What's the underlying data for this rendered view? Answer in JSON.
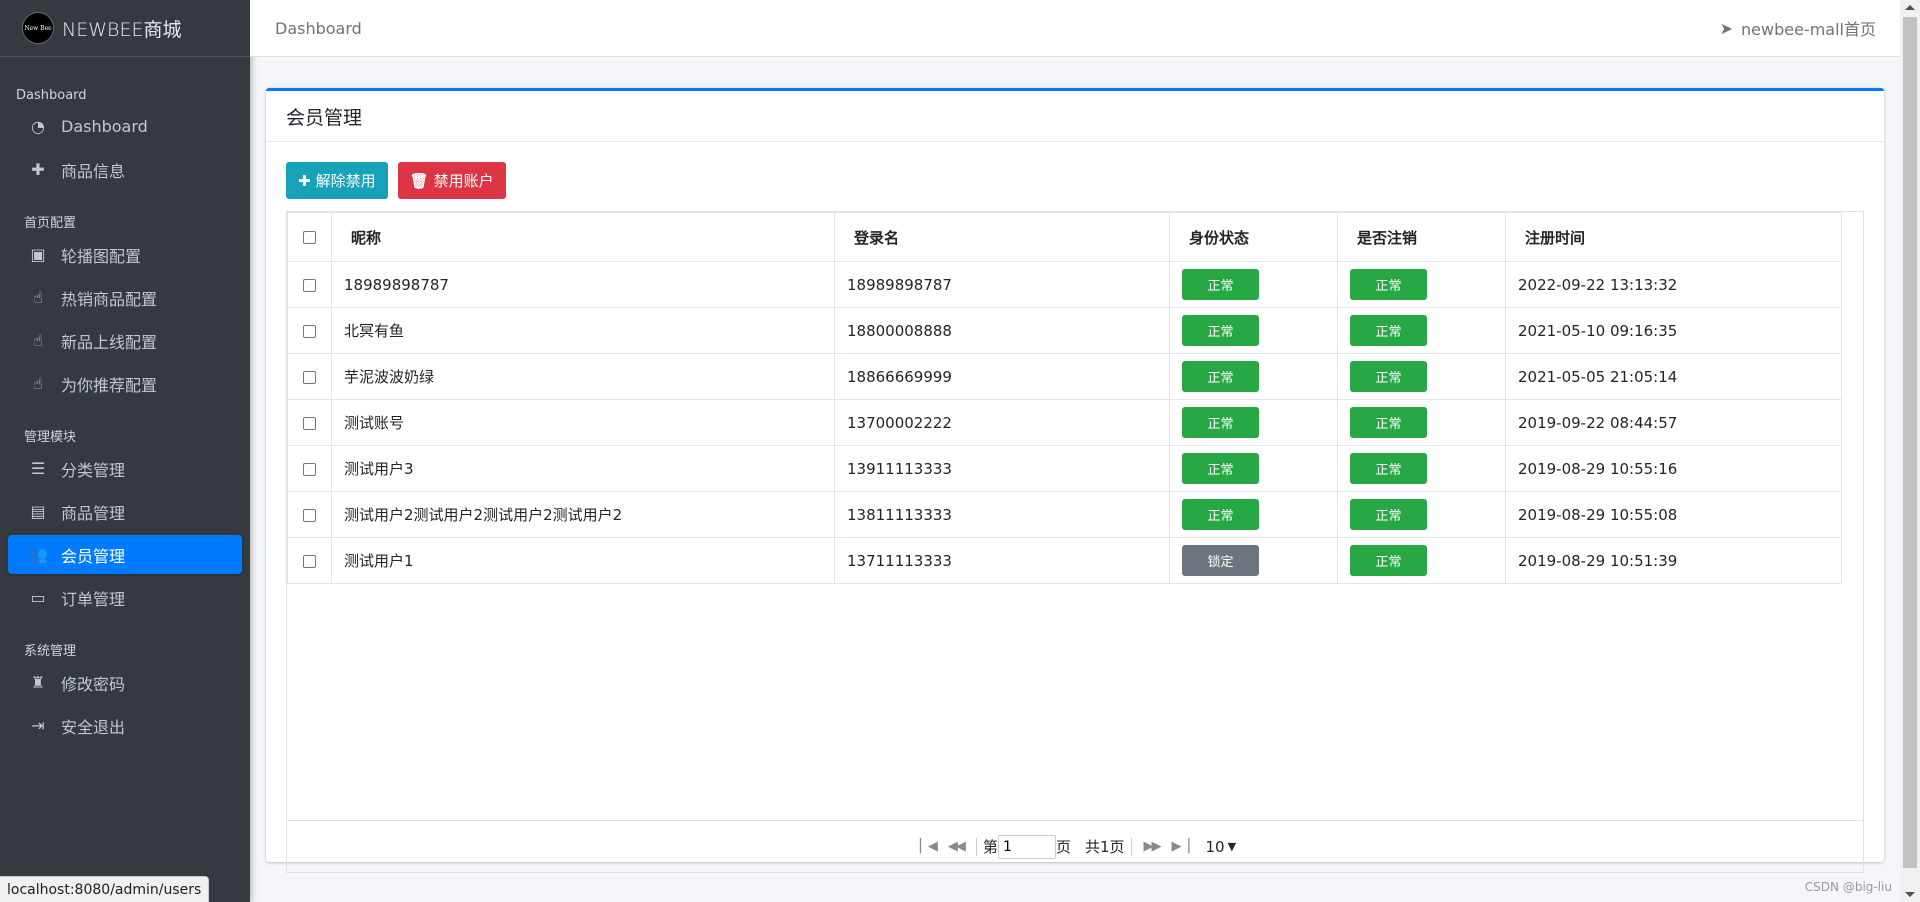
{
  "brand": {
    "logo_text": "New Bee",
    "title": "NEWBEE商城"
  },
  "sidebar": {
    "sections": [
      {
        "header": "Dashboard",
        "items": [
          {
            "label": "Dashboard",
            "icon": "tachometer-icon"
          },
          {
            "label": "商品信息",
            "icon": "plus-icon"
          }
        ]
      },
      {
        "header": "首页配置",
        "items": [
          {
            "label": "轮播图配置",
            "icon": "image-icon"
          },
          {
            "label": "热销商品配置",
            "icon": "hand-pointer-icon"
          },
          {
            "label": "新品上线配置",
            "icon": "hand-pointer-icon"
          },
          {
            "label": "为你推荐配置",
            "icon": "hand-pointer-icon"
          }
        ]
      },
      {
        "header": "管理模块",
        "items": [
          {
            "label": "分类管理",
            "icon": "list-icon"
          },
          {
            "label": "商品管理",
            "icon": "archive-icon"
          },
          {
            "label": "会员管理",
            "icon": "users-icon",
            "active": true
          },
          {
            "label": "订单管理",
            "icon": "money-bill-icon"
          }
        ]
      },
      {
        "header": "系统管理",
        "items": [
          {
            "label": "修改密码",
            "icon": "user-secret-icon"
          },
          {
            "label": "安全退出",
            "icon": "sign-out-icon"
          }
        ]
      }
    ]
  },
  "topbar": {
    "breadcrumb": "Dashboard",
    "home_link": "newbee-mall首页"
  },
  "card": {
    "title": "会员管理",
    "buttons": {
      "unban": "解除禁用",
      "ban": "禁用账户"
    }
  },
  "table": {
    "columns": [
      "昵称",
      "登录名",
      "身份状态",
      "是否注销",
      "注册时间"
    ],
    "rows": [
      {
        "nick": "18989898787",
        "login": "18989898787",
        "status": "正常",
        "deleted": "正常",
        "time": "2022-09-22 13:13:32"
      },
      {
        "nick": "北冥有鱼",
        "login": "18800008888",
        "status": "正常",
        "deleted": "正常",
        "time": "2021-05-10 09:16:35"
      },
      {
        "nick": "芋泥波波奶绿",
        "login": "18866669999",
        "status": "正常",
        "deleted": "正常",
        "time": "2021-05-05 21:05:14"
      },
      {
        "nick": "测试账号",
        "login": "13700002222",
        "status": "正常",
        "deleted": "正常",
        "time": "2019-09-22 08:44:57"
      },
      {
        "nick": "测试用户3",
        "login": "13911113333",
        "status": "正常",
        "deleted": "正常",
        "time": "2019-08-29 10:55:16"
      },
      {
        "nick": "测试用户2测试用户2测试用户2测试用户2",
        "login": "13811113333",
        "status": "正常",
        "deleted": "正常",
        "time": "2019-08-29 10:55:08"
      },
      {
        "nick": "测试用户1",
        "login": "13711113333",
        "status": "锁定",
        "deleted": "正常",
        "time": "2019-08-29 10:51:39"
      }
    ]
  },
  "pager": {
    "prefix": "第",
    "page_value": "1",
    "suffix": "页",
    "total": "共1页",
    "page_size": "10"
  },
  "colors": {
    "sidebar_bg": "#343a40",
    "active": "#007bff",
    "btn_info": "#17a2b8",
    "btn_danger": "#dc3545",
    "badge_ok": "#28a745",
    "badge_lock": "#6c757d"
  },
  "status_bar": "localhost:8080/admin/users",
  "watermark": "CSDN @big-liu"
}
